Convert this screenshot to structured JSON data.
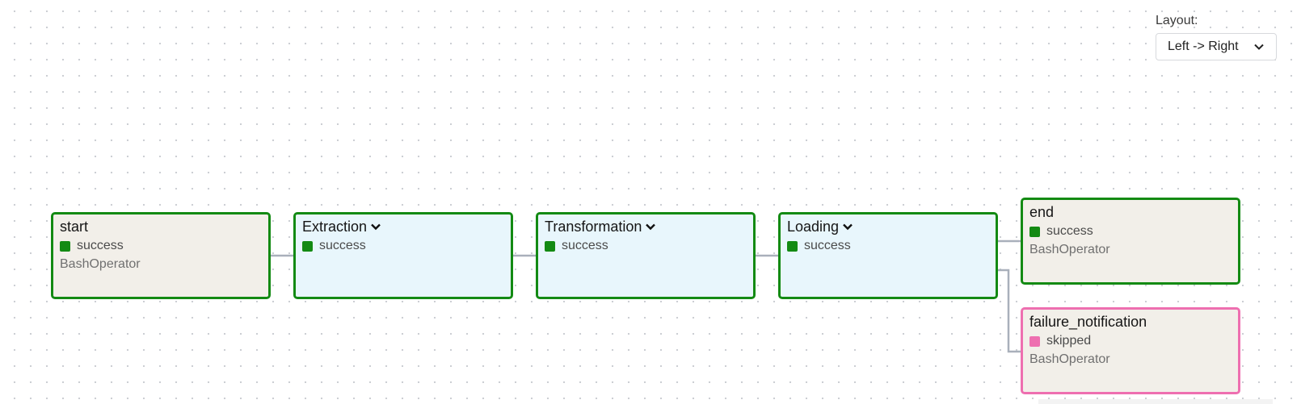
{
  "layout": {
    "label": "Layout:",
    "value": "Left -> Right",
    "icon": "chevron-down-icon"
  },
  "nodes": {
    "start": {
      "title": "start",
      "status": "success",
      "operator": "BashOperator"
    },
    "extraction": {
      "title": "Extraction",
      "status": "success",
      "icon": "chevron-down-icon"
    },
    "transformation": {
      "title": "Transformation",
      "status": "success",
      "icon": "chevron-down-icon"
    },
    "loading": {
      "title": "Loading",
      "status": "success",
      "icon": "chevron-down-icon"
    },
    "end": {
      "title": "end",
      "status": "success",
      "operator": "BashOperator"
    },
    "failure_notification": {
      "title": "failure_notification",
      "status": "skipped",
      "operator": "BashOperator"
    }
  },
  "colors": {
    "success": "#138a13",
    "skipped": "#ee6fb0",
    "task_bg": "#f2efe9",
    "group_bg": "#e8f6fc",
    "edge": "#a9b0bb"
  }
}
